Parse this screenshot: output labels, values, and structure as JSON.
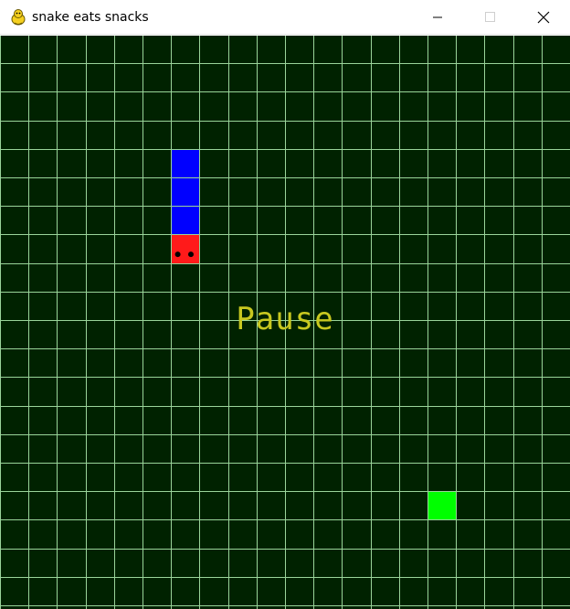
{
  "window": {
    "title": "snake eats snacks",
    "icon": "pygame-snake-icon",
    "buttons": [
      "minimize",
      "maximize",
      "close"
    ]
  },
  "game": {
    "status_text": "Pause",
    "board_color": "#002200",
    "grid_color": "#9ad49a",
    "grid_columns": 20,
    "grid_rows": 20,
    "snake_head": {
      "col": 6,
      "row": 7,
      "color": "#ff1a1a",
      "eye_color": "#000000"
    },
    "snake_body": [
      {
        "col": 6,
        "row": 4
      },
      {
        "col": 6,
        "row": 5
      },
      {
        "col": 6,
        "row": 6
      }
    ],
    "snake_body_color": "#0000ff",
    "snack": {
      "col": 15,
      "row": 16,
      "color": "#00ff00"
    },
    "status_color": "#c8c820"
  }
}
